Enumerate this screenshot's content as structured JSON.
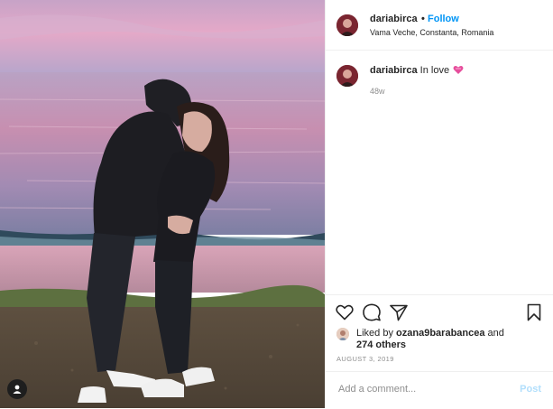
{
  "post": {
    "photo_alt": "",
    "author": {
      "username": "dariabirca",
      "follow_label": "Follow",
      "separator": "•",
      "location": "Vama Veche, Constanta, Romania"
    },
    "caption": {
      "username": "dariabirca",
      "text": "In love",
      "emoji_icon": "heart-ribbon-emoji",
      "time_ago": "48w"
    },
    "likes": {
      "prefix": "Liked by",
      "liker": "ozana9barabancea",
      "conjunction": "and",
      "others": "274 others"
    },
    "date": "AUGUST 3, 2019",
    "add_comment": {
      "placeholder": "Add a comment...",
      "post_label": "Post"
    },
    "icons": {
      "like": "heart-icon",
      "comment": "comment-icon",
      "share": "share-icon",
      "save": "bookmark-icon",
      "tag": "user-tag-icon"
    },
    "colors": {
      "follow": "#0095f6",
      "post_disabled": "#b2dffc",
      "text": "#262626",
      "muted": "#8e8e8e"
    }
  }
}
